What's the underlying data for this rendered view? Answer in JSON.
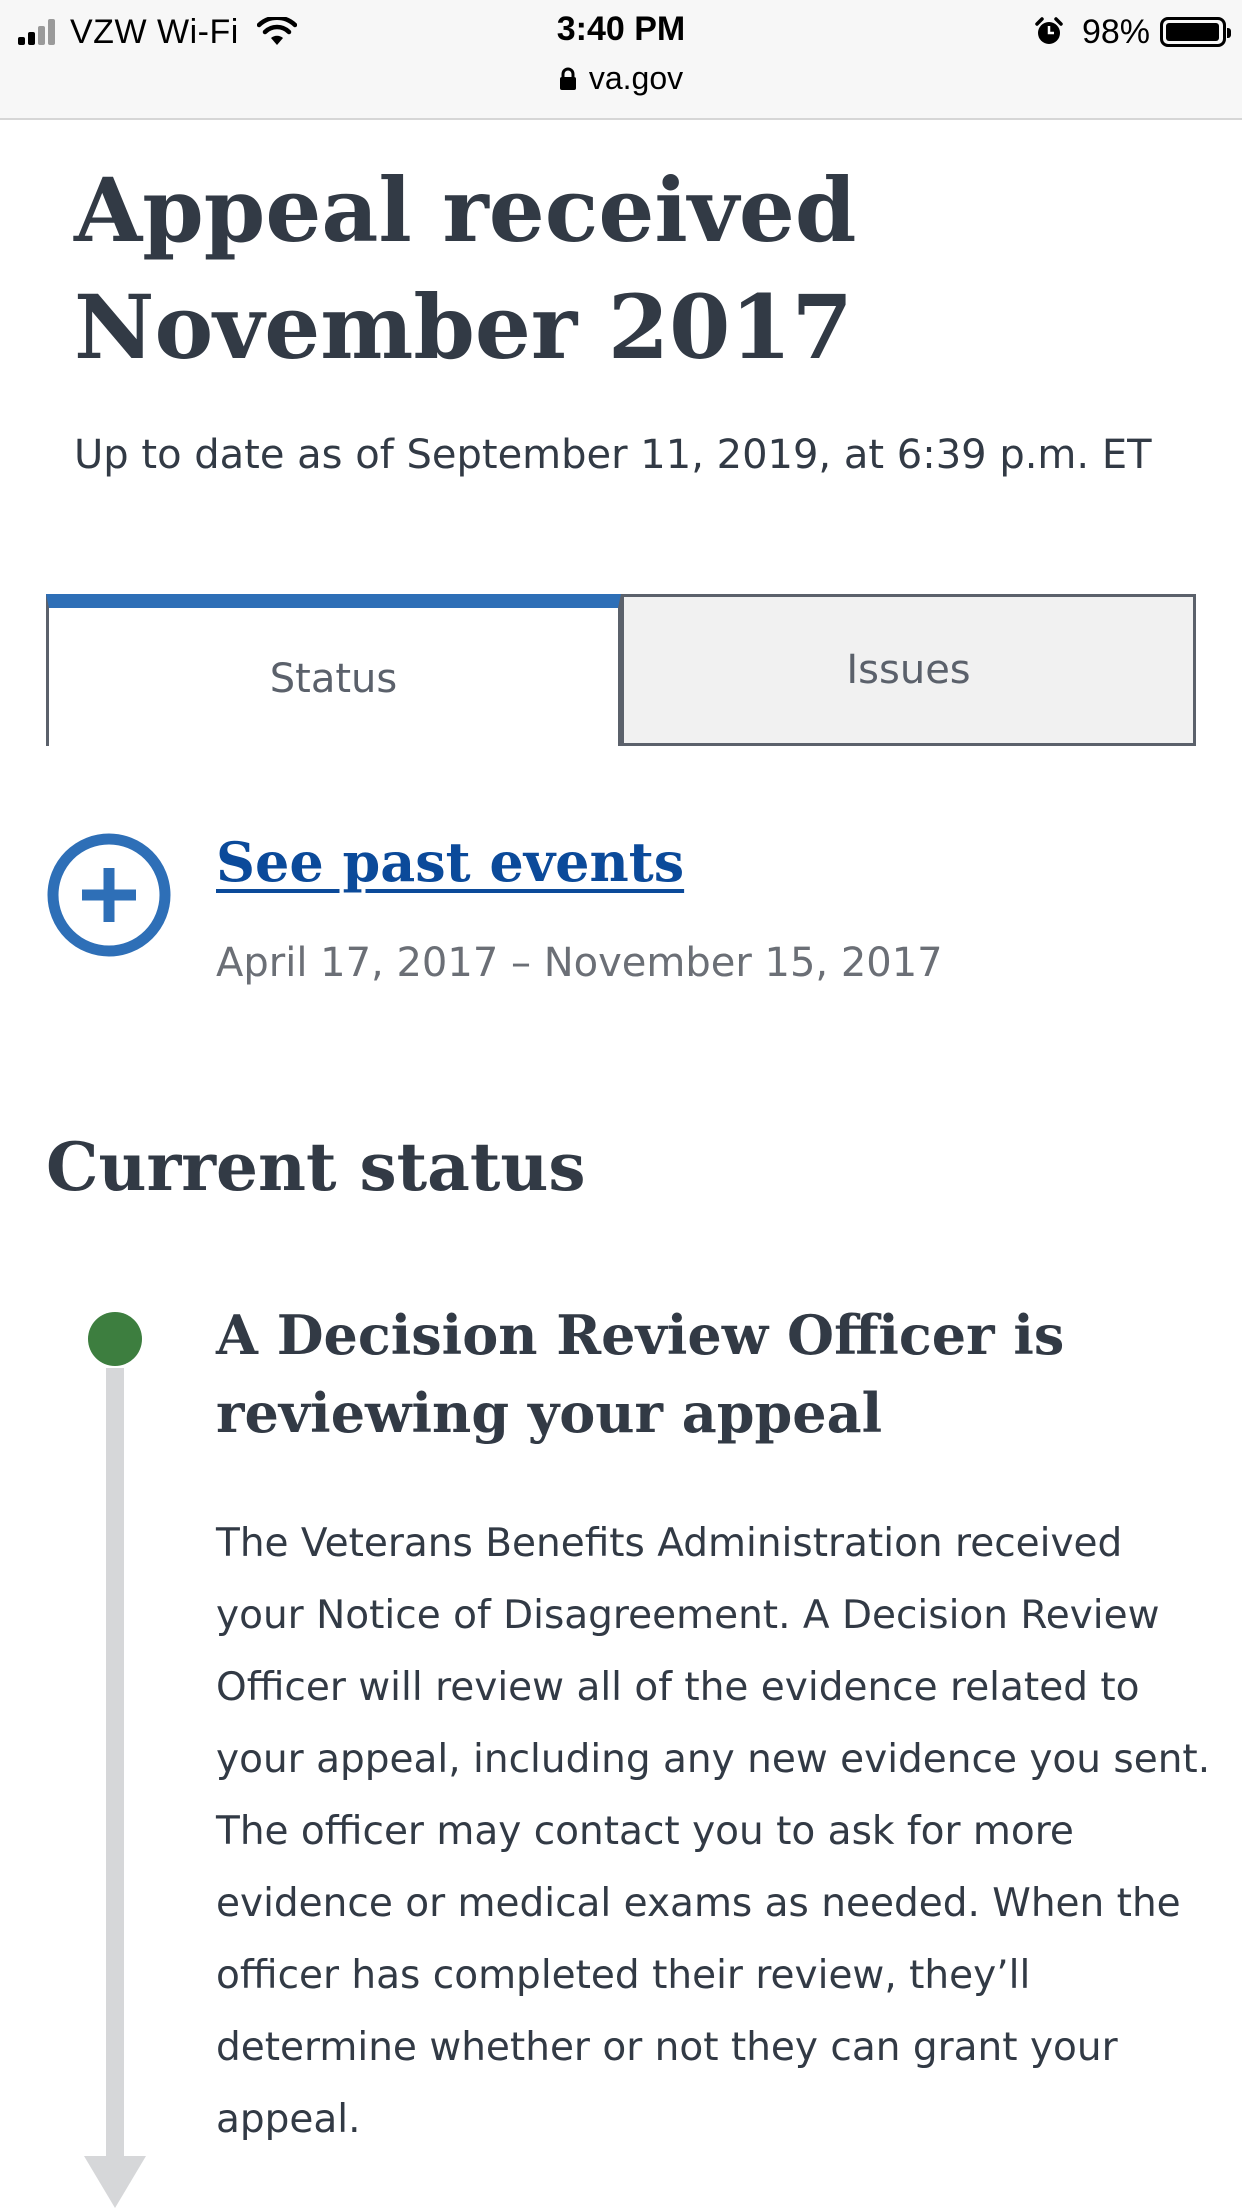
{
  "status_bar": {
    "carrier": "VZW Wi-Fi",
    "time": "3:40 PM",
    "url": "va.gov",
    "battery_percent": "98%",
    "battery_level": 0.98,
    "signal_bars": 2,
    "icons": [
      "signal-icon",
      "wifi-icon",
      "lock-icon",
      "alarm-icon",
      "battery-icon"
    ]
  },
  "page": {
    "title_line1": "Appeal received",
    "title_line2": "November 2017",
    "updated": "Up to date as of September 11, 2019, at 6:39 p.m. ET"
  },
  "tabs": [
    {
      "label": "Status",
      "active": true
    },
    {
      "label": "Issues",
      "active": false
    }
  ],
  "past_events": {
    "link_text": "See past events",
    "date_range": "April 17, 2017 – November 15, 2017",
    "icon": "plus-circle-icon"
  },
  "current_status": {
    "heading": "Current status",
    "title_line1": "A Decision Review Officer is",
    "title_line2": "reviewing your appeal",
    "description": "The Veterans Benefits Administration received your Notice of Disagreement. A Decision Review Officer will review all of the evidence related to your appeal, including any new evidence you sent. The officer may contact you to ask for more evidence or medical exams as needed. When the officer has completed their review, they’ll determine whether or not they can grant your appeal."
  },
  "colors": {
    "accent_blue": "#2e6fb7",
    "link_blue": "#0b4a9a",
    "status_green": "#3d7e3f",
    "text_dark": "#323a45",
    "timeline_gray": "#d6d7d9"
  }
}
